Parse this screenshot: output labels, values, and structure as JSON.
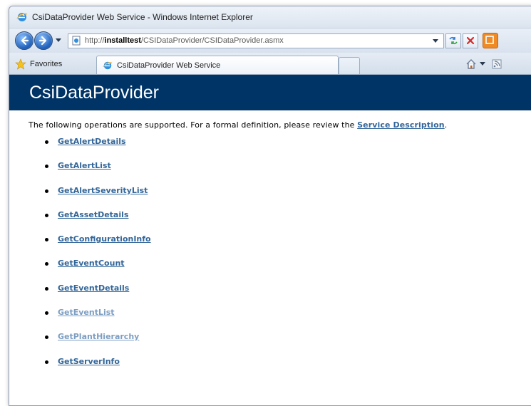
{
  "window": {
    "title": "CsiDataProvider Web Service - Windows Internet Explorer"
  },
  "address_bar": {
    "prefix": "http://",
    "host": "installtest",
    "path": "/CSIDataProvider/CSIDataProvider.asmx"
  },
  "favorites": {
    "label": "Favorites"
  },
  "tab": {
    "label": "CsiDataProvider Web Service"
  },
  "page": {
    "heading": "CsiDataProvider",
    "intro_text": "The following operations are supported. For a formal definition, please review the ",
    "service_description_link": "Service Description",
    "intro_end": ".",
    "operations": [
      {
        "label": "GetAlertDetails"
      },
      {
        "label": "GetAlertList"
      },
      {
        "label": "GetAlertSeverityList"
      },
      {
        "label": "GetAssetDetails"
      },
      {
        "label": "GetConfigurationInfo"
      },
      {
        "label": "GetEventCount"
      },
      {
        "label": "GetEventDetails"
      },
      {
        "label": "GetEventList"
      },
      {
        "label": "GetPlantHierarchy"
      },
      {
        "label": "GetServerInfo"
      }
    ]
  },
  "colors": {
    "header_bg": "#003366",
    "link": "#336699",
    "link_faded": "#7d9ec2"
  },
  "icons": {
    "title": "ie-logo-icon",
    "back": "back-arrow-icon",
    "forward": "forward-arrow-icon",
    "refresh": "refresh-icon",
    "stop": "stop-icon",
    "feeds": "feeds-icon",
    "favorites": "favorites-star-icon",
    "home": "home-icon",
    "rss": "rss-icon"
  }
}
